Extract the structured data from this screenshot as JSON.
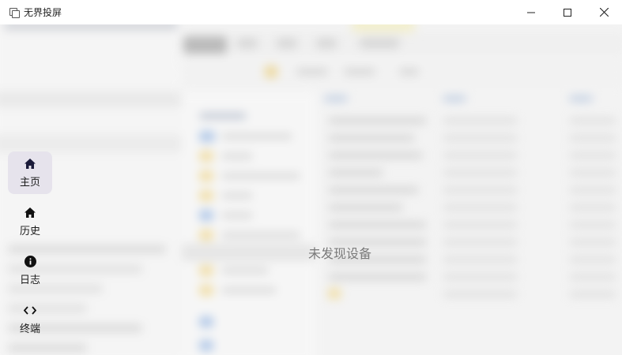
{
  "window": {
    "title": "无界投屏",
    "icon": "app-window-icon",
    "controls": [
      "minimize-icon",
      "maximize-icon",
      "close-icon"
    ]
  },
  "nav": {
    "items": [
      {
        "label": "主页",
        "icon": "home-icon",
        "active": true
      },
      {
        "label": "历史",
        "icon": "home-icon",
        "active": false
      },
      {
        "label": "日志",
        "icon": "info-icon",
        "active": false
      },
      {
        "label": "终端",
        "icon": "code-icon",
        "active": false
      }
    ]
  },
  "main": {
    "empty_message": "未发现设备"
  },
  "colors": {
    "titlebar": "#ffffff",
    "background": "#f3f3f3",
    "nav_active": "#e6e3ec",
    "message": "#7a7a7a"
  }
}
